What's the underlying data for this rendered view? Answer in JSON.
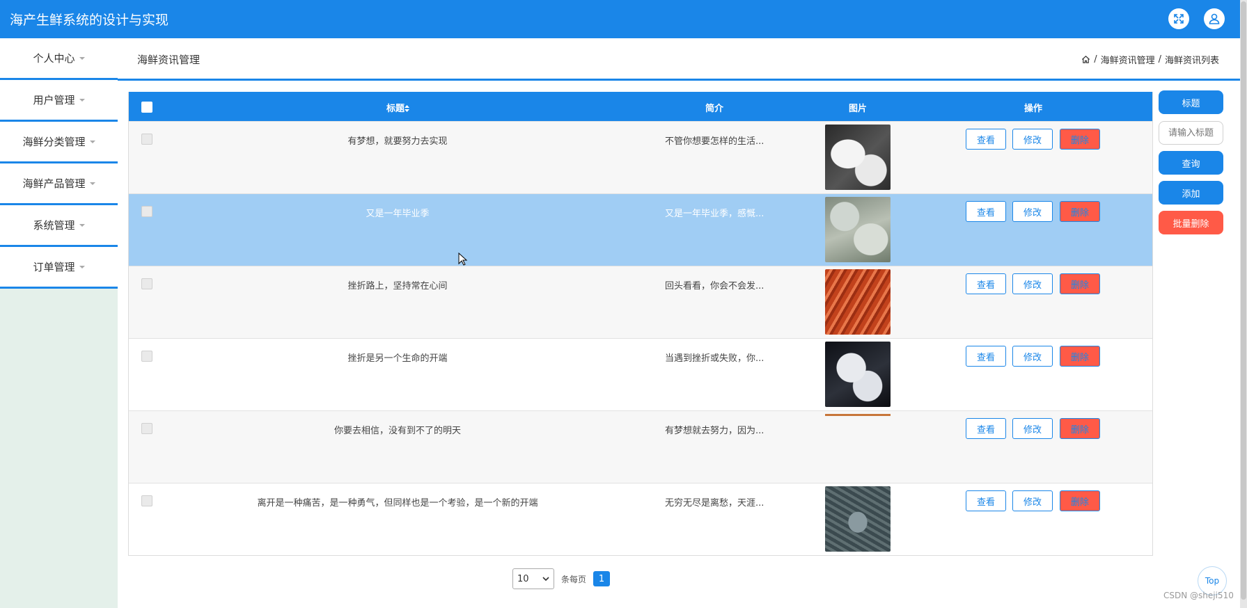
{
  "app": {
    "title": "海产生鲜系统的设计与实现"
  },
  "header": {
    "icons": [
      "fullscreen-icon",
      "user-icon"
    ]
  },
  "sidebar": {
    "items": [
      {
        "label": "个人中心"
      },
      {
        "label": "用户管理"
      },
      {
        "label": "海鲜分类管理"
      },
      {
        "label": "海鲜产品管理"
      },
      {
        "label": "系统管理"
      },
      {
        "label": "订单管理"
      }
    ]
  },
  "page": {
    "title": "海鲜资讯管理",
    "breadcrumb": [
      "海鲜资讯管理",
      "海鲜资讯列表"
    ],
    "breadcrumb_sep": "/"
  },
  "table": {
    "headers": {
      "title": "标题",
      "intro": "简介",
      "image": "图片",
      "actions": "操作"
    },
    "buttons": {
      "view": "查看",
      "edit": "修改",
      "delete": "删除"
    },
    "rows": [
      {
        "title": "有梦想，就要努力去实现",
        "intro": "不管你想要怎样的生活..."
      },
      {
        "title": "又是一年毕业季",
        "intro": "又是一年毕业季，感慨..."
      },
      {
        "title": "挫折路上，坚持常在心间",
        "intro": "回头看看，你会不会发..."
      },
      {
        "title": "挫折是另一个生命的开端",
        "intro": "当遇到挫折或失败，你..."
      },
      {
        "title": "你要去相信，没有到不了的明天",
        "intro": "有梦想就去努力，因为..."
      },
      {
        "title": "离开是一种痛苦，是一种勇气，但同样也是一个考验，是一个新的开端",
        "intro": "无穷无尽是离愁，天涯..."
      }
    ]
  },
  "search_panel": {
    "field_label": "标题",
    "placeholder": "请输入标题",
    "query": "查询",
    "add": "添加",
    "batch_delete": "批量删除"
  },
  "pagination": {
    "page_size": "10",
    "per_page_label": "条每页",
    "current_page": "1"
  },
  "misc": {
    "top": "Top",
    "watermark": "CSDN @sheji510"
  },
  "colors": {
    "primary": "#1a86e8",
    "danger": "#ff5a47",
    "row_highlight": "#a0cdf4",
    "sidebar_bg": "#e4f0ea"
  }
}
